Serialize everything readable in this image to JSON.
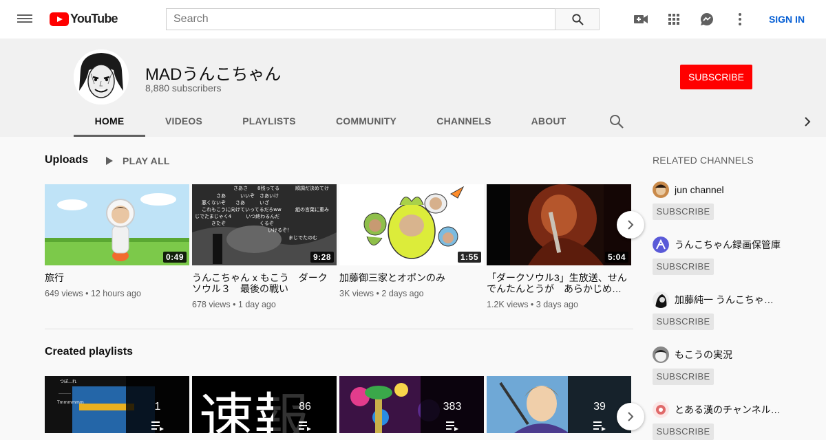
{
  "masthead": {
    "logo_text": "YouTube",
    "search_placeholder": "Search",
    "sign_in_label": "SIGN IN",
    "icons": [
      "menu-icon",
      "video-camera-add-icon",
      "apps-grid-icon",
      "messages-icon",
      "more-vert-icon",
      "search-icon"
    ]
  },
  "channel": {
    "name": "MADうんこちゃん",
    "subscribers": "8,880 subscribers",
    "subscribe_label": "SUBSCRIBE",
    "tabs": [
      "HOME",
      "VIDEOS",
      "PLAYLISTS",
      "COMMUNITY",
      "CHANNELS",
      "ABOUT"
    ],
    "active_tab": "HOME"
  },
  "uploads": {
    "title": "Uploads",
    "play_all_label": "PLAY ALL",
    "videos": [
      {
        "title": "旅行",
        "duration": "0:49",
        "views": "649 views",
        "age": "12 hours ago"
      },
      {
        "title": "うんこちゃん x もこう　ダークソウル３　最後の戦い",
        "duration": "9:28",
        "views": "678 views",
        "age": "1 day ago"
      },
      {
        "title": "加藤御三家とオポンのみ",
        "duration": "1:55",
        "views": "3K views",
        "age": "2 days ago"
      },
      {
        "title": "「ダークソウル3」生放送、せんでんたんとうが　あらかじめ…",
        "duration": "5:04",
        "views": "1.2K views",
        "age": "3 days ago"
      }
    ]
  },
  "playlists": {
    "title": "Created playlists",
    "items": [
      {
        "count": "1"
      },
      {
        "count": "86"
      },
      {
        "count": "383"
      },
      {
        "count": "39"
      }
    ]
  },
  "sidebar": {
    "title": "RELATED CHANNELS",
    "subscribe_label": "SUBSCRIBE",
    "channels": [
      {
        "name": "jun channel"
      },
      {
        "name": "うんこちゃん録画保管庫"
      },
      {
        "name": "加藤純一 うんこちゃん雑談"
      },
      {
        "name": "もこうの実況"
      },
      {
        "name": "とある漢のチャンネル加藤"
      }
    ]
  },
  "colors": {
    "brand_red": "#ff0000",
    "link_blue": "#065fd4",
    "background": "#f9f9f9",
    "header_band": "#f1f1f1"
  }
}
